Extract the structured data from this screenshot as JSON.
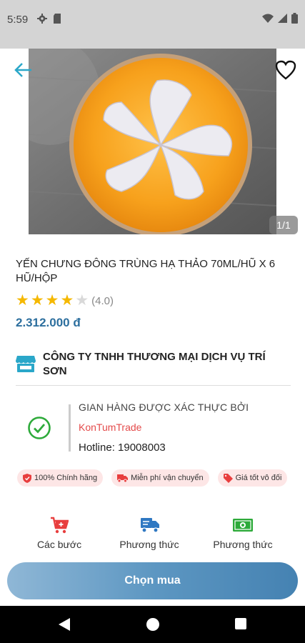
{
  "status_bar": {
    "time": "5:59",
    "left_icons": [
      "gear-icon",
      "sd-card-icon"
    ],
    "right_icons": [
      "wifi-icon",
      "signal-icon",
      "battery-icon"
    ]
  },
  "product": {
    "image_counter": "1/1",
    "title": "YẾN CHƯNG ĐÔNG TRÙNG HẠ THẢO 70ML/HŨ X 6 HŨ/HỘP",
    "rating": 4,
    "rating_max": 5,
    "rating_text": "(4.0)",
    "price": "2.312.000 đ"
  },
  "shop": {
    "name": "CÔNG TY TNHH THƯƠNG MẠI DỊCH VỤ TRÍ SƠN"
  },
  "verification": {
    "label": "GIAN HÀNG ĐƯỢC XÁC THỰC BỞI",
    "org": "KonTumTrade",
    "hotline": "Hotline: 19008003"
  },
  "badges": [
    {
      "label": "100% Chính hãng",
      "icon": "shield-icon"
    },
    {
      "label": "Miễn phí vận chuyển",
      "icon": "truck-icon"
    },
    {
      "label": "Giá tốt vô đối",
      "icon": "tag-icon"
    }
  ],
  "features": [
    {
      "label": "Các bước",
      "icon": "cart-icon"
    },
    {
      "label": "Phương thức",
      "icon": "delivery-truck-icon"
    },
    {
      "label": "Phương thức",
      "icon": "cash-icon"
    }
  ],
  "buy_button": {
    "label": "Chọn mua"
  },
  "colors": {
    "price": "#2d6f9e",
    "star_on": "#f5b800",
    "verify_green": "#2daa3a",
    "org_red": "#e44a4a",
    "badge_bg": "#fde6e6",
    "button_gradient_end": "#4582b2"
  }
}
